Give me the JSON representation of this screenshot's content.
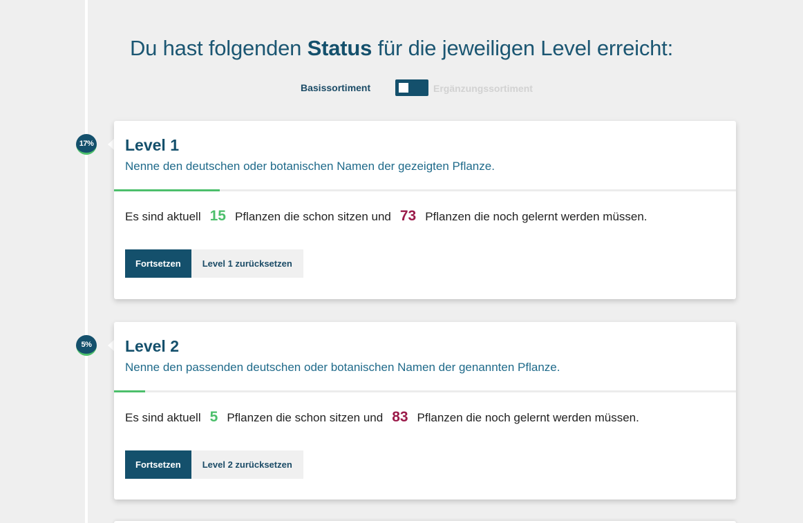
{
  "header": {
    "heading_before": "Du hast folgenden ",
    "heading_bold": "Status",
    "heading_after": " für die jeweiligen Level erreicht:"
  },
  "toggle": {
    "left_label": "Basissortiment",
    "right_label": "Ergänzungssortiment",
    "state": "left"
  },
  "levels": [
    {
      "badge": "17%",
      "progress_percent": 17,
      "title": "Level 1",
      "description": "Nenne den deutschen oder botanischen Namen der gezeigten Pflanze.",
      "stats_prefix": "Es sind aktuell",
      "known_count": "15",
      "stats_middle": "Pflanzen die schon sitzen und",
      "unknown_count": "73",
      "stats_suffix": "Pflanzen die noch gelernt werden müssen.",
      "continue_label": "Fortsetzen",
      "reset_label": "Level 1 zurücksetzen"
    },
    {
      "badge": "5%",
      "progress_percent": 5,
      "title": "Level 2",
      "description": "Nenne den passenden deutschen oder botanischen Namen der genannten Pflanze.",
      "stats_prefix": "Es sind aktuell",
      "known_count": "5",
      "stats_middle": "Pflanzen die schon sitzen und",
      "unknown_count": "83",
      "stats_suffix": "Pflanzen die noch gelernt werden müssen.",
      "continue_label": "Fortsetzen",
      "reset_label": "Level 2 zurücksetzen"
    }
  ],
  "colors": {
    "primary": "#14506c",
    "accent_green": "#4cbf6b",
    "accent_red": "#9b1b4a",
    "background": "#efefef"
  }
}
